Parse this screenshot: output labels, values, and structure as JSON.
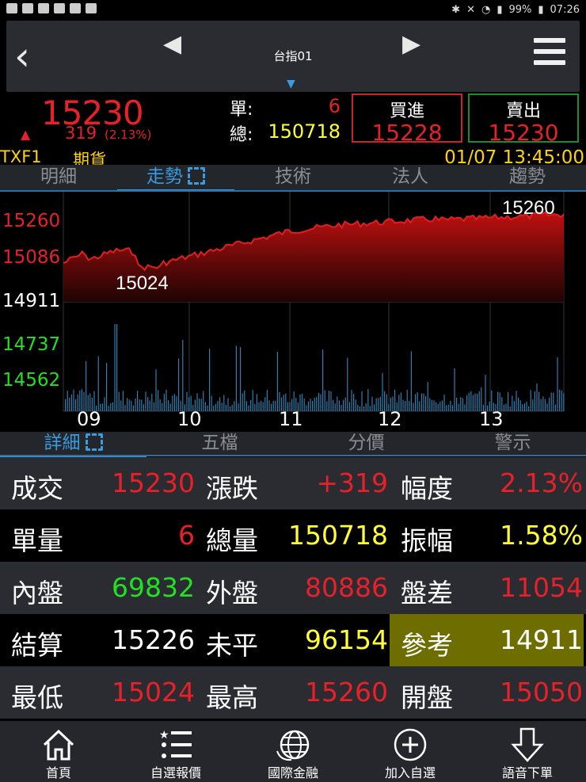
{
  "status": {
    "battery": "99%",
    "time": "07:26"
  },
  "nav": {
    "title": "台指01"
  },
  "quote": {
    "last": "15230",
    "change": "319",
    "change_pct": "(2.13%)",
    "unit_label": "單:",
    "unit_val": "6",
    "total_label": "總:",
    "total_val": "150718",
    "buy_label": "買進",
    "buy_price": "15228",
    "sell_label": "賣出",
    "sell_price": "15230",
    "symbol": "TXF1",
    "type": "期貨",
    "datetime": "01/07 13:45:00"
  },
  "tabs": [
    "明細",
    "走勢",
    "技術",
    "法人",
    "趨勢"
  ],
  "chart": {
    "y_labels": [
      {
        "text": "15260",
        "color": "#e8202a"
      },
      {
        "text": "15086",
        "color": "#e8202a"
      },
      {
        "text": "14911",
        "color": "#ffffff"
      },
      {
        "text": "14737",
        "color": "#22e022"
      },
      {
        "text": "14562",
        "color": "#22e022"
      }
    ],
    "x_labels": [
      "09",
      "10",
      "11",
      "12",
      "13"
    ],
    "high_label": "15260",
    "low_label": "15024"
  },
  "detail_tabs": [
    "詳細",
    "五檔",
    "分價",
    "警示"
  ],
  "grid": [
    [
      {
        "label": "成交",
        "value": "15230",
        "color": "red"
      },
      {
        "label": "漲跌",
        "value": "+319",
        "color": "red"
      },
      {
        "label": "幅度",
        "value": "2.13%",
        "color": "red"
      }
    ],
    [
      {
        "label": "單量",
        "value": "6",
        "color": "red"
      },
      {
        "label": "總量",
        "value": "150718",
        "color": "yellow"
      },
      {
        "label": "振幅",
        "value": "1.58%",
        "color": "yellow"
      }
    ],
    [
      {
        "label": "內盤",
        "value": "69832",
        "color": "green"
      },
      {
        "label": "外盤",
        "value": "80886",
        "color": "red"
      },
      {
        "label": "盤差",
        "value": "11054",
        "color": "red"
      }
    ],
    [
      {
        "label": "結算",
        "value": "15226",
        "color": "white"
      },
      {
        "label": "未平",
        "value": "96154",
        "color": "yellow"
      },
      {
        "label": "參考",
        "value": "14911",
        "color": "white"
      }
    ],
    [
      {
        "label": "最低",
        "value": "15024",
        "color": "red"
      },
      {
        "label": "最高",
        "value": "15260",
        "color": "red"
      },
      {
        "label": "開盤",
        "value": "15050",
        "color": "red"
      }
    ]
  ],
  "bottom": [
    "首頁",
    "自選報價",
    "國際金融",
    "加入自選",
    "語音下單"
  ]
}
